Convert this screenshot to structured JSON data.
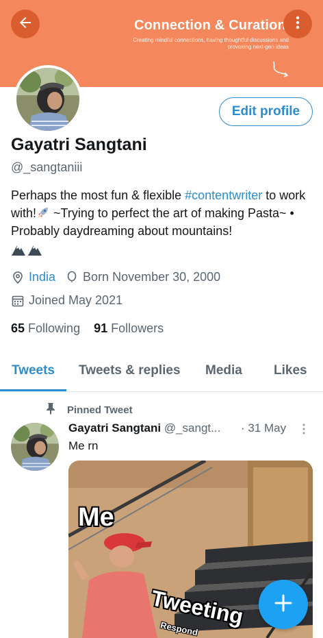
{
  "header": {
    "banner_title": "Connection & Curation",
    "banner_subtitle": "Creating mindful connections, having thoughtful discussions and provoking next-gen ideas",
    "banner_color": "#f5875c"
  },
  "profile": {
    "name": "Gayatri Sangtani",
    "handle": "@_sangtaniii",
    "edit_label": "Edit profile",
    "bio_part1": "Perhaps the most fun & flexible ",
    "bio_hashtag": "#contentwriter",
    "bio_part2": " to work with!",
    "bio_part3": " ~Trying to perfect the art of making Pasta~ • Probably daydreaming about mountains!",
    "location": "India",
    "birthday": "Born November 30, 2000",
    "joined": "Joined May 2021",
    "following_count": "65",
    "following_label": "Following",
    "followers_count": "91",
    "followers_label": "Followers"
  },
  "tabs": [
    {
      "label": "Tweets",
      "active": true
    },
    {
      "label": "Tweets & replies",
      "active": false
    },
    {
      "label": "Media",
      "active": false
    },
    {
      "label": "Likes",
      "active": false
    }
  ],
  "pinned_tweet": {
    "pinned_label": "Pinned Tweet",
    "author_name": "Gayatri Sangtani",
    "author_handle": "@_sangt...",
    "date": "· 31 May",
    "text": "Me rn",
    "meme_top": "Me",
    "meme_mid": "Tweeting",
    "meme_bottom": "Respond"
  },
  "icons": {
    "back": "arrow-left-icon",
    "more": "more-vertical-icon",
    "location": "location-pin-icon",
    "birthday": "balloon-icon",
    "calendar": "calendar-icon",
    "pin": "pin-icon",
    "compose": "plus-icon"
  },
  "colors": {
    "accent": "#2d8bd0",
    "fab": "#1da1f2",
    "banner": "#f5875c"
  }
}
